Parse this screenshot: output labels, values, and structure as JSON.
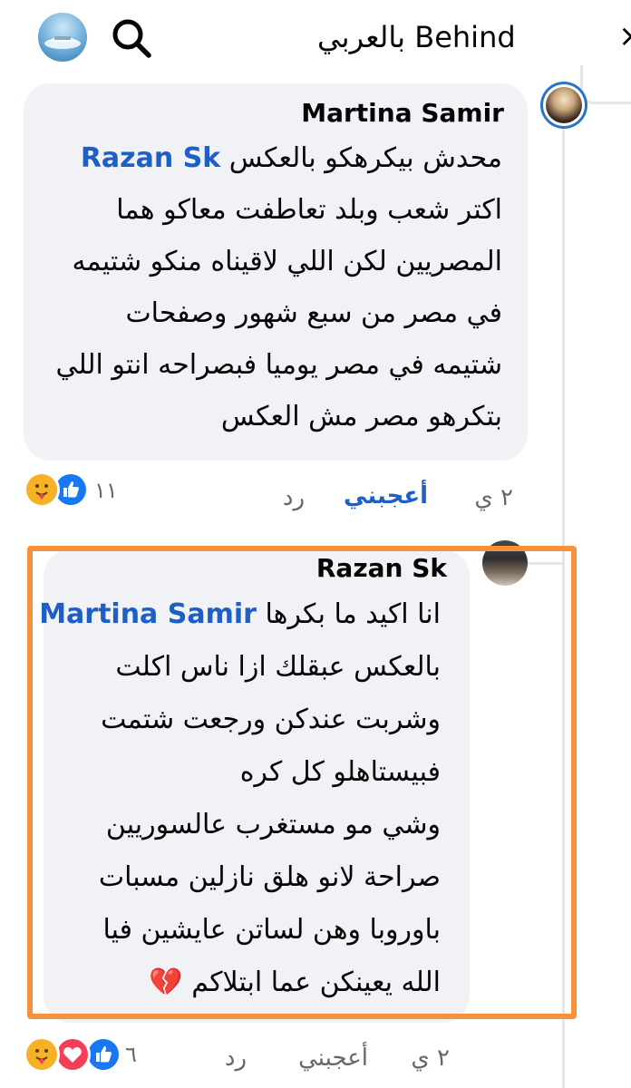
{
  "header": {
    "title": "بالعربي Behind",
    "close_glyph": "×"
  },
  "comments": [
    {
      "author": "Martina Samir",
      "mention": "Razan Sk",
      "lines": [
        "محدش بيكرهكو بالعكس",
        "اكتر شعب وبلد تعاطفت معاكو هما",
        "المصريين لكن اللي لاقيناه منكو شتيمه",
        "في مصر من سبع شهور وصفحات",
        "شتيمه في مصر يوميا فبصراحه انتو اللي",
        "بتكرهو مصر مش العكس"
      ],
      "time": "٢ ي",
      "like_label": "أعجبني",
      "reply_label": "رد",
      "reaction_count": "١١",
      "reactions": [
        "like-icon",
        "care-icon"
      ]
    },
    {
      "author": "Razan Sk",
      "mention": "Martina Samir",
      "lines": [
        "انا اكيد ما بكرها",
        "بالعكس عبقلك ازا ناس اكلت",
        "وشربت عندكن ورجعت شتمت",
        "فبيستاهلو كل كره",
        "وشي مو مستغرب عالسوريين",
        "صراحة لانو هلق نازلين مسبات",
        "باوروبا وهن لساتن عايشين فيا",
        "الله يعينكن عما ابتلاكم"
      ],
      "emoji": "💔",
      "time": "٢ ي",
      "like_label": "أعجبني",
      "reply_label": "رد",
      "reaction_count": "٦",
      "reactions": [
        "like-icon",
        "love-icon",
        "care-icon"
      ]
    }
  ],
  "colors": {
    "mention": "#1d5fc4",
    "bubble": "#f0f2f5",
    "highlight": "#f7923a",
    "like": "#1877f2",
    "love": "#f33e58",
    "care": "#f7b125"
  }
}
